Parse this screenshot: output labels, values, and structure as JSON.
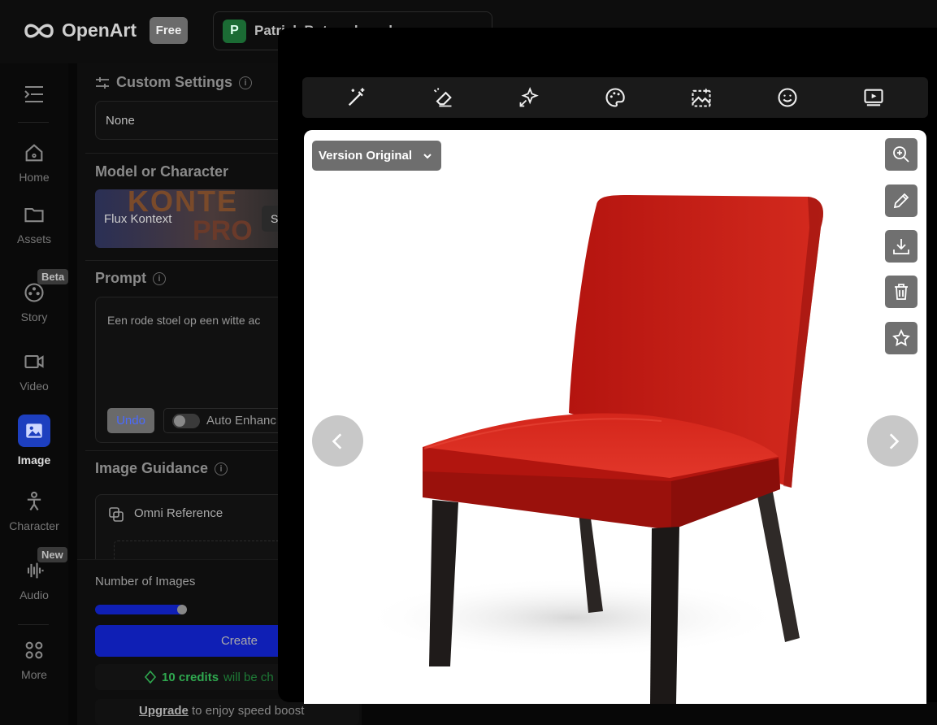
{
  "app": {
    "brand": "OpenArt",
    "plan_badge": "Free",
    "user_initial": "P",
    "user_name": "Patrick Bots...ebrands"
  },
  "nav": {
    "items": [
      {
        "label": "Home",
        "icon": "home-icon"
      },
      {
        "label": "Assets",
        "icon": "folder-icon"
      },
      {
        "label": "Story",
        "icon": "film-reel-icon",
        "badge": "Beta"
      },
      {
        "label": "Video",
        "icon": "video-camera-icon"
      },
      {
        "label": "Image",
        "icon": "image-icon",
        "active": true
      },
      {
        "label": "Character",
        "icon": "person-icon"
      },
      {
        "label": "Audio",
        "icon": "audio-wave-icon",
        "badge": "New"
      },
      {
        "label": "More",
        "icon": "grid-icon"
      }
    ]
  },
  "panel": {
    "custom_settings": {
      "title": "Custom Settings",
      "value": "None"
    },
    "model": {
      "title": "Model or Character",
      "name": "Flux Kontext",
      "thumb_text_1": "KONTE",
      "thumb_text_2": "PRO",
      "switch_label": "S"
    },
    "prompt": {
      "title": "Prompt",
      "text": "Een rode stoel op een witte ac",
      "undo_label": "Undo",
      "auto_enhance_label": "Auto Enhanc"
    },
    "guidance": {
      "title": "Image Guidance",
      "omni_label": "Omni Reference"
    },
    "images": {
      "label": "Number of Images",
      "slider_fraction": 0.97
    },
    "create_label": "Create",
    "credits": {
      "amount": "10 credits",
      "suffix": "will be ch"
    },
    "upgrade": {
      "link": "Upgrade",
      "text": "to enjoy speed boost"
    }
  },
  "viewer": {
    "version_label": "Version Original",
    "toolbar_icons": [
      "magic-wand-icon",
      "eraser-icon",
      "sparkles-icon",
      "palette-icon",
      "landscape-icon",
      "smile-icon",
      "play-screen-icon"
    ],
    "side_actions": [
      "zoom-in-icon",
      "pencil-icon",
      "download-icon",
      "trash-icon",
      "star-icon"
    ]
  },
  "colors": {
    "accent_blue": "#1d3fbf",
    "create_button": "#0f1fb5",
    "chair_red": "#c51d16",
    "credits_green": "#2fa84f"
  }
}
